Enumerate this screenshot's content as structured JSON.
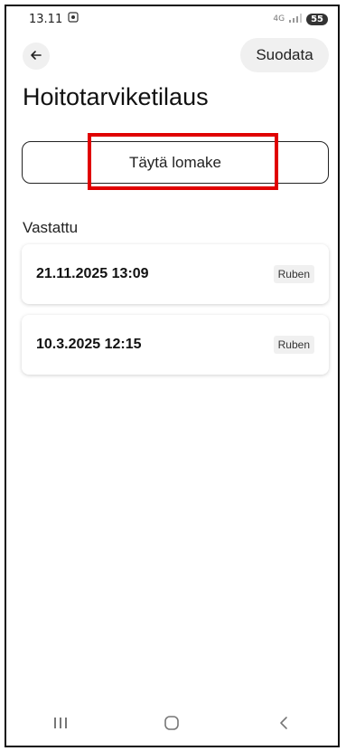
{
  "status": {
    "time": "13.11",
    "screenshot_icon": "screenshot-icon",
    "network": "4G",
    "battery": "55"
  },
  "header": {
    "back_icon": "arrow-left-icon",
    "filter_label": "Suodata",
    "title": "Hoitotarviketilaus"
  },
  "actions": {
    "fill_form_label": "Täytä lomake"
  },
  "section": {
    "answered_label": "Vastattu"
  },
  "entries": [
    {
      "date": "21.11.2025 13:09",
      "tag": "Ruben"
    },
    {
      "date": "10.3.2025 12:15",
      "tag": "Ruben"
    }
  ],
  "navbar": {
    "recents_icon": "recents-icon",
    "home_icon": "home-icon",
    "back_icon": "back-chevron-icon"
  },
  "accent_colors": {
    "highlight": "#e00000"
  }
}
